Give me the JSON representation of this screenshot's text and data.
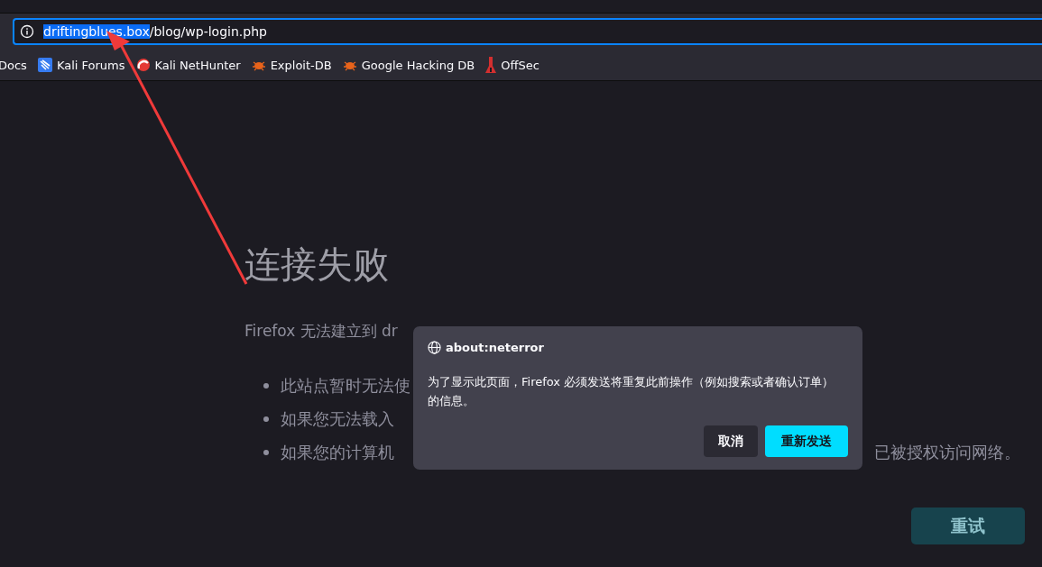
{
  "address_bar": {
    "selected_text": "driftingblues.box",
    "rest_text": "/blog/wp-login.php"
  },
  "bookmarks": [
    {
      "label": "Docs",
      "kind": "plain"
    },
    {
      "label": "Kali Forums",
      "kind": "dragon"
    },
    {
      "label": "Kali NetHunter",
      "kind": "nethunter"
    },
    {
      "label": "Exploit-DB",
      "kind": "bug"
    },
    {
      "label": "Google Hacking DB",
      "kind": "bug"
    },
    {
      "label": "OffSec",
      "kind": "tower"
    }
  ],
  "error_page": {
    "title": "连接失败",
    "intro": "Firefox 无法建立到 dr",
    "bullets": [
      {
        "text": "此站点暂时无法使"
      },
      {
        "text": "如果您无法载入"
      },
      {
        "text": "如果您的计算机",
        "tail": "已被授权访问网络。"
      }
    ],
    "retry_button": "重试"
  },
  "dialog": {
    "title": "about:neterror",
    "message": "为了显示此页面，Firefox 必须发送将重复此前操作（例如搜索或者确认订单）的信息。",
    "buttons": [
      {
        "label": "取消",
        "kind": "secondary"
      },
      {
        "label": "重新发送",
        "kind": "primary"
      }
    ]
  }
}
